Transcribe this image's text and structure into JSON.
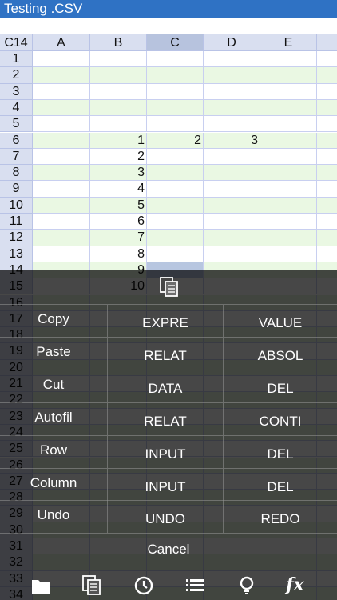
{
  "title": "Testing .CSV",
  "sheet": {
    "corner": "C14",
    "columns": [
      "A",
      "B",
      "C",
      "D",
      "E"
    ],
    "rows": [
      {
        "n": "1",
        "cells": [
          "",
          "",
          "",
          "",
          ""
        ]
      },
      {
        "n": "2",
        "cells": [
          "",
          "",
          "",
          "",
          ""
        ]
      },
      {
        "n": "3",
        "cells": [
          "",
          "",
          "",
          "",
          ""
        ]
      },
      {
        "n": "4",
        "cells": [
          "",
          "",
          "",
          "",
          ""
        ]
      },
      {
        "n": "5",
        "cells": [
          "",
          "",
          "",
          "",
          ""
        ]
      },
      {
        "n": "6",
        "cells": [
          "",
          "1",
          "2",
          "3",
          ""
        ]
      },
      {
        "n": "7",
        "cells": [
          "",
          "2",
          "",
          "",
          ""
        ]
      },
      {
        "n": "8",
        "cells": [
          "",
          "3",
          "",
          "",
          ""
        ]
      },
      {
        "n": "9",
        "cells": [
          "",
          "4",
          "",
          "",
          ""
        ]
      },
      {
        "n": "10",
        "cells": [
          "",
          "5",
          "",
          "",
          ""
        ]
      },
      {
        "n": "11",
        "cells": [
          "",
          "6",
          "",
          "",
          ""
        ]
      },
      {
        "n": "12",
        "cells": [
          "",
          "7",
          "",
          "",
          ""
        ]
      },
      {
        "n": "13",
        "cells": [
          "",
          "8",
          "",
          "",
          ""
        ]
      },
      {
        "n": "14",
        "cells": [
          "",
          "9",
          "",
          "",
          ""
        ]
      },
      {
        "n": "15",
        "cells": [
          "",
          "10",
          "",
          "",
          ""
        ]
      },
      {
        "n": "16",
        "cells": [
          "",
          "",
          "",
          "",
          ""
        ]
      },
      {
        "n": "17",
        "cells": [
          "",
          "",
          "",
          "",
          ""
        ]
      },
      {
        "n": "18",
        "cells": [
          "",
          "",
          "",
          "",
          ""
        ]
      },
      {
        "n": "19",
        "cells": [
          "",
          "",
          "",
          "",
          ""
        ]
      },
      {
        "n": "20",
        "cells": [
          "",
          "",
          "",
          "",
          ""
        ]
      },
      {
        "n": "21",
        "cells": [
          "",
          "",
          "",
          "",
          ""
        ]
      },
      {
        "n": "22",
        "cells": [
          "",
          "",
          "",
          "",
          ""
        ]
      },
      {
        "n": "23",
        "cells": [
          "",
          "",
          "",
          "",
          ""
        ]
      },
      {
        "n": "24",
        "cells": [
          "",
          "",
          "",
          "",
          ""
        ]
      },
      {
        "n": "25",
        "cells": [
          "",
          "",
          "",
          "",
          ""
        ]
      },
      {
        "n": "26",
        "cells": [
          "",
          "",
          "",
          "",
          ""
        ]
      },
      {
        "n": "27",
        "cells": [
          "",
          "",
          "",
          "",
          ""
        ]
      },
      {
        "n": "28",
        "cells": [
          "",
          "",
          "",
          "",
          ""
        ]
      },
      {
        "n": "29",
        "cells": [
          "",
          "",
          "",
          "",
          ""
        ]
      },
      {
        "n": "30",
        "cells": [
          "",
          "",
          "",
          "",
          ""
        ]
      },
      {
        "n": "31",
        "cells": [
          "",
          "",
          "",
          "",
          ""
        ]
      },
      {
        "n": "32",
        "cells": [
          "",
          "",
          "",
          "",
          ""
        ]
      },
      {
        "n": "33",
        "cells": [
          "",
          "",
          "",
          "",
          ""
        ]
      },
      {
        "n": "34",
        "cells": [
          "",
          "",
          "",
          "",
          ""
        ]
      }
    ]
  },
  "menu": {
    "icon": "paste-icon",
    "rows": [
      {
        "label": "Copy",
        "opt1": "EXPRE",
        "opt2": "VALUE"
      },
      {
        "label": "Paste",
        "opt1": "RELAT",
        "opt2": "ABSOL"
      },
      {
        "label": "Cut",
        "opt1": "DATA",
        "opt2": "DEL"
      },
      {
        "label": "Autofil",
        "opt1": "RELAT",
        "opt2": "CONTI"
      },
      {
        "label": "Row",
        "opt1": "INPUT",
        "opt2": "DEL"
      },
      {
        "label": "Column",
        "opt1": "INPUT",
        "opt2": "DEL"
      },
      {
        "label": "Undo",
        "opt1": "UNDO",
        "opt2": "REDO"
      }
    ],
    "cancel": "Cancel"
  },
  "toolbar": {
    "icons": [
      "folder-icon",
      "paste-icon",
      "clock-icon",
      "list-icon",
      "bulb-icon",
      "fx-icon"
    ],
    "fx_label": "fx"
  },
  "colors": {
    "titlebar": "#2f72c4",
    "header": "#d9dff0",
    "row_alt": "#eaf8e3",
    "selected": "#b7c6e0"
  }
}
